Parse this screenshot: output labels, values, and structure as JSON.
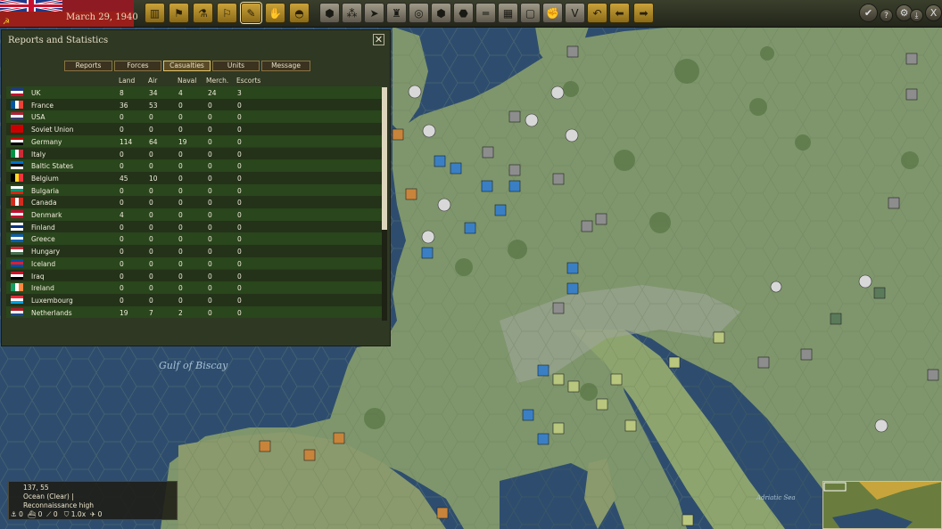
{
  "topbar": {
    "date": "March 29, 1940",
    "buttons": [
      "production-icon",
      "research-icon",
      "science-icon",
      "flag-icon",
      "report-icon",
      "diplomacy-icon",
      "helmet-icon"
    ],
    "action_buttons": [
      "hex-icon",
      "group-icon",
      "move-icon",
      "unit-icon",
      "target-icon",
      "hex2-icon",
      "hex3-icon",
      "line-icon",
      "grid-icon",
      "frame-icon",
      "hand-icon",
      "v-icon",
      "undo-icon",
      "back-icon",
      "forward-icon"
    ],
    "right_buttons": [
      "end-turn-icon",
      "help-icon",
      "settings-icon",
      "save-icon",
      "close-icon"
    ],
    "help_label": "?",
    "v_label": "V",
    "close_label": "X"
  },
  "reports": {
    "title": "Reports and Statistics",
    "close_label": "✕",
    "tabs": [
      "Reports",
      "Forces",
      "Casualties",
      "Units",
      "Message"
    ],
    "selected_tab": "Casualties",
    "columns": [
      "Land",
      "Air",
      "Naval",
      "Merch.",
      "Escorts"
    ],
    "rows": [
      {
        "country": "UK",
        "land": "8",
        "air": "34",
        "naval": "4",
        "merch": "24",
        "escorts": "3"
      },
      {
        "country": "France",
        "land": "36",
        "air": "53",
        "naval": "0",
        "merch": "0",
        "escorts": "0"
      },
      {
        "country": "USA",
        "land": "0",
        "air": "0",
        "naval": "0",
        "merch": "0",
        "escorts": "0"
      },
      {
        "country": "Soviet Union",
        "land": "0",
        "air": "0",
        "naval": "0",
        "merch": "0",
        "escorts": "0"
      },
      {
        "country": "Germany",
        "land": "114",
        "air": "64",
        "naval": "19",
        "merch": "0",
        "escorts": "0"
      },
      {
        "country": "Italy",
        "land": "0",
        "air": "0",
        "naval": "0",
        "merch": "0",
        "escorts": "0"
      },
      {
        "country": "Baltic States",
        "land": "0",
        "air": "0",
        "naval": "0",
        "merch": "0",
        "escorts": "0"
      },
      {
        "country": "Belgium",
        "land": "45",
        "air": "10",
        "naval": "0",
        "merch": "0",
        "escorts": "0"
      },
      {
        "country": "Bulgaria",
        "land": "0",
        "air": "0",
        "naval": "0",
        "merch": "0",
        "escorts": "0"
      },
      {
        "country": "Canada",
        "land": "0",
        "air": "0",
        "naval": "0",
        "merch": "0",
        "escorts": "0"
      },
      {
        "country": "Denmark",
        "land": "4",
        "air": "0",
        "naval": "0",
        "merch": "0",
        "escorts": "0"
      },
      {
        "country": "Finland",
        "land": "0",
        "air": "0",
        "naval": "0",
        "merch": "0",
        "escorts": "0"
      },
      {
        "country": "Greece",
        "land": "0",
        "air": "0",
        "naval": "0",
        "merch": "0",
        "escorts": "0"
      },
      {
        "country": "Hungary",
        "land": "0",
        "air": "0",
        "naval": "0",
        "merch": "0",
        "escorts": "0"
      },
      {
        "country": "Iceland",
        "land": "0",
        "air": "0",
        "naval": "0",
        "merch": "0",
        "escorts": "0"
      },
      {
        "country": "Iraq",
        "land": "0",
        "air": "0",
        "naval": "0",
        "merch": "0",
        "escorts": "0"
      },
      {
        "country": "Ireland",
        "land": "0",
        "air": "0",
        "naval": "0",
        "merch": "0",
        "escorts": "0"
      },
      {
        "country": "Luxembourg",
        "land": "0",
        "air": "0",
        "naval": "0",
        "merch": "0",
        "escorts": "0"
      },
      {
        "country": "Netherlands",
        "land": "19",
        "air": "7",
        "naval": "2",
        "merch": "0",
        "escorts": "0"
      }
    ]
  },
  "map": {
    "sea_label": "Gulf of Biscay",
    "sea_label2": "Adriatic Sea",
    "sea_color": "#2e4d6e",
    "land_color": "#7f966c"
  },
  "info": {
    "coords": "137, 55",
    "terrain": "Ocean (Clear)  |",
    "recon": "Reconnaissance high",
    "stats": [
      "0",
      "0",
      "0",
      "1.0x",
      "0"
    ]
  },
  "colors": {
    "panel_bg": "#2f3823",
    "row_alt": "#2a461c",
    "row_norm": "#233219",
    "gold": "#caa23a"
  }
}
